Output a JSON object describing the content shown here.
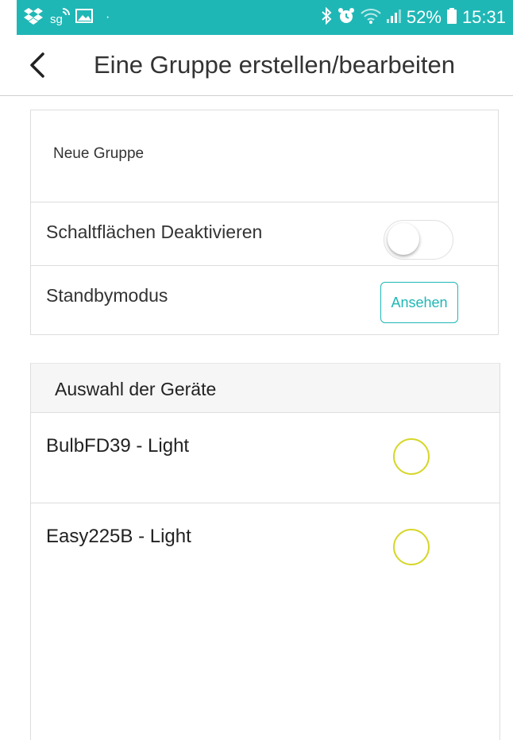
{
  "status_bar": {
    "battery": "52%",
    "time": "15:31",
    "left_icons": [
      "dropbox-icon",
      "sg-cast-icon",
      "gallery-icon"
    ],
    "right_icons": [
      "bluetooth-icon",
      "alarm-icon",
      "wifi-icon",
      "signal-icon",
      "battery-icon"
    ]
  },
  "header": {
    "title": "Eine Gruppe erstellen/bearbeiten",
    "back_icon": "chevron-left-icon"
  },
  "group_settings": {
    "group_name_value": "Neue Gruppe",
    "disable_buttons_label": "Schaltflächen Deaktivieren",
    "disable_buttons_on": false,
    "standby_label": "Standbymodus",
    "standby_button_label": "Ansehen"
  },
  "devices": {
    "section_title": "Auswahl der Geräte",
    "items": [
      {
        "name": "BulbFD39 - Light",
        "selected": false
      },
      {
        "name": "Easy225B - Light",
        "selected": false
      }
    ]
  },
  "colors": {
    "accent": "#1fb7b5",
    "radio_outline": "#d6d62a"
  }
}
